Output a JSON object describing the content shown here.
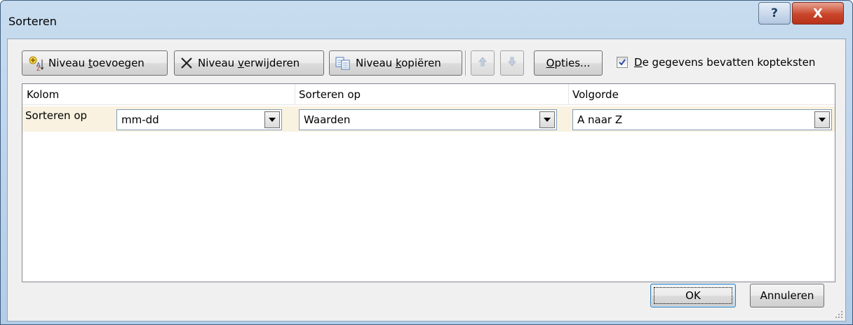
{
  "window": {
    "title": "Sorteren",
    "help_label": "?",
    "close_label": "X"
  },
  "toolbar": {
    "add_level": {
      "pre": "Niveau ",
      "key": "t",
      "post": "oevoegen"
    },
    "delete_level": {
      "pre": "Niveau ",
      "key": "v",
      "post": "erwijderen"
    },
    "copy_level": {
      "pre": "Niveau ",
      "key": "k",
      "post": "opiëren"
    },
    "options": {
      "pre": "",
      "key": "O",
      "post": "pties..."
    },
    "headers_checkbox": {
      "key": "D",
      "post": "e gegevens bevatten kopteksten",
      "checked": true
    }
  },
  "grid": {
    "headers": {
      "column": "Kolom",
      "sort_on": "Sorteren op",
      "order": "Volgorde"
    },
    "rows": [
      {
        "label": "Sorteren op",
        "column_value": "mm-dd",
        "sort_on_value": "Waarden",
        "order_value": "A naar Z"
      }
    ]
  },
  "footer": {
    "ok_label": "OK",
    "cancel_label": "Annuleren"
  }
}
